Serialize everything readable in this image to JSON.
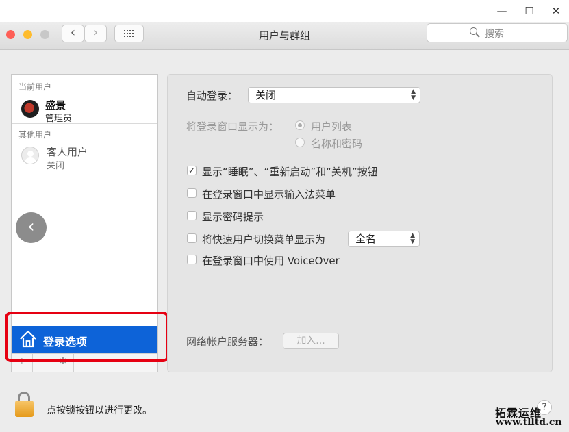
{
  "outer_window": {
    "minimize_symbol": "—",
    "maximize_symbol": "☐",
    "close_symbol": "✕"
  },
  "titlebar": {
    "title": "用户与群组",
    "back_symbol": "‹",
    "forward_symbol": "›",
    "search_placeholder": "搜索"
  },
  "sidebar": {
    "current_users_label": "当前用户",
    "current_user": {
      "name": "盛景",
      "role": "管理员"
    },
    "other_users_label": "其他用户",
    "guest_user": {
      "name": "客人用户",
      "status": "关闭"
    },
    "login_options_label": "登录选项",
    "add_symbol": "+",
    "remove_symbol": "−",
    "gear_symbol": "✱"
  },
  "overlay": {
    "back_symbol": "‹"
  },
  "panel": {
    "auto_login_label": "自动登录：",
    "auto_login_value": "关闭",
    "display_login_as_label": "将登录窗口显示为：",
    "radio_options": [
      {
        "label": "用户列表",
        "selected": true
      },
      {
        "label": "名称和密码",
        "selected": false
      }
    ],
    "checkboxes": [
      {
        "label": "显示“睡眠”、“重新启动”和“关机”按钮",
        "checked": true
      },
      {
        "label": "在登录窗口中显示输入法菜单",
        "checked": false
      },
      {
        "label": "显示密码提示",
        "checked": false
      },
      {
        "label": "将快速用户切换菜单显示为",
        "checked": false
      },
      {
        "label": "在登录窗口中使用 VoiceOver",
        "checked": false
      }
    ],
    "fast_user_switch_value": "全名",
    "network_account_label": "网络帐户服务器：",
    "join_button": "加入..."
  },
  "footer": {
    "lock_text": "点按锁按钮以进行更改。",
    "help_symbol": "?"
  },
  "watermark": {
    "name": "拓霖运维",
    "url": "www.tlltd.cn"
  },
  "colors": {
    "selection_blue": "#0d63d8",
    "highlight_red": "#e60012",
    "traffic_close": "#fe5f57",
    "traffic_minimize": "#febc2e",
    "traffic_zoom": "#c8c8c8"
  }
}
